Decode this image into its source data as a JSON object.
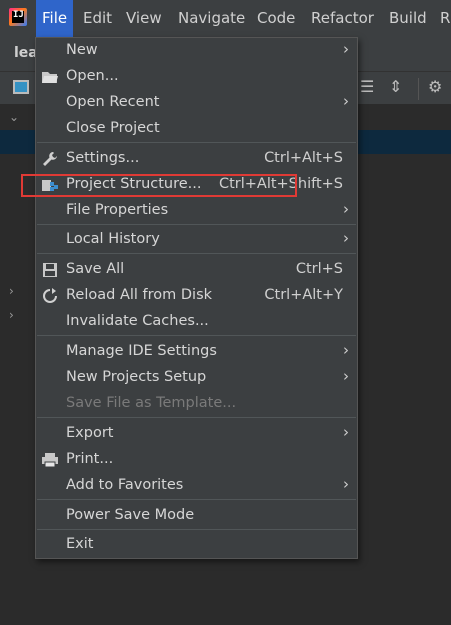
{
  "app": {
    "logo_text": "IJ"
  },
  "menubar": {
    "items": [
      {
        "label": "File",
        "mnemonic_index": 0,
        "active": true
      },
      {
        "label": "Edit",
        "mnemonic_index": 0
      },
      {
        "label": "View",
        "mnemonic_index": 0
      },
      {
        "label": "Navigate",
        "mnemonic_index": 0
      },
      {
        "label": "Code",
        "mnemonic_index": 0
      },
      {
        "label": "Refactor",
        "mnemonic_index": 0
      },
      {
        "label": "Build",
        "mnemonic_index": 0
      },
      {
        "label": "Ru",
        "mnemonic_index": 0
      }
    ]
  },
  "tab": {
    "label": "lea"
  },
  "file_menu": {
    "items": [
      {
        "label": "New",
        "submenu": true,
        "icon": "none"
      },
      {
        "label": "Open...",
        "icon": "folder-icon"
      },
      {
        "label": "Open Recent",
        "submenu": true
      },
      {
        "label": "Close Project"
      },
      {
        "label": "Settings...",
        "shortcut": "Ctrl+Alt+S",
        "icon": "wrench-icon"
      },
      {
        "label": "Project Structure...",
        "shortcut": "Ctrl+Alt+Shift+S",
        "icon": "project-structure-icon",
        "highlighted": true
      },
      {
        "label": "File Properties",
        "submenu": true
      },
      {
        "label": "Local History",
        "submenu": true
      },
      {
        "label": "Save All",
        "shortcut": "Ctrl+S",
        "icon": "save-icon"
      },
      {
        "label": "Reload All from Disk",
        "shortcut": "Ctrl+Alt+Y",
        "icon": "reload-icon"
      },
      {
        "label": "Invalidate Caches..."
      },
      {
        "label": "Manage IDE Settings",
        "submenu": true
      },
      {
        "label": "New Projects Setup",
        "submenu": true
      },
      {
        "label": "Save File as Template...",
        "disabled": true
      },
      {
        "label": "Export",
        "submenu": true
      },
      {
        "label": "Print...",
        "icon": "printer-icon"
      },
      {
        "label": "Add to Favorites",
        "submenu": true
      },
      {
        "label": "Power Save Mode"
      },
      {
        "label": "Exit"
      }
    ]
  },
  "colors": {
    "menubar_bg": "#3c3f41",
    "active_menu": "#2f65ca",
    "highlight_box": "#e03a35",
    "editor_bg": "#2b2b2b"
  }
}
